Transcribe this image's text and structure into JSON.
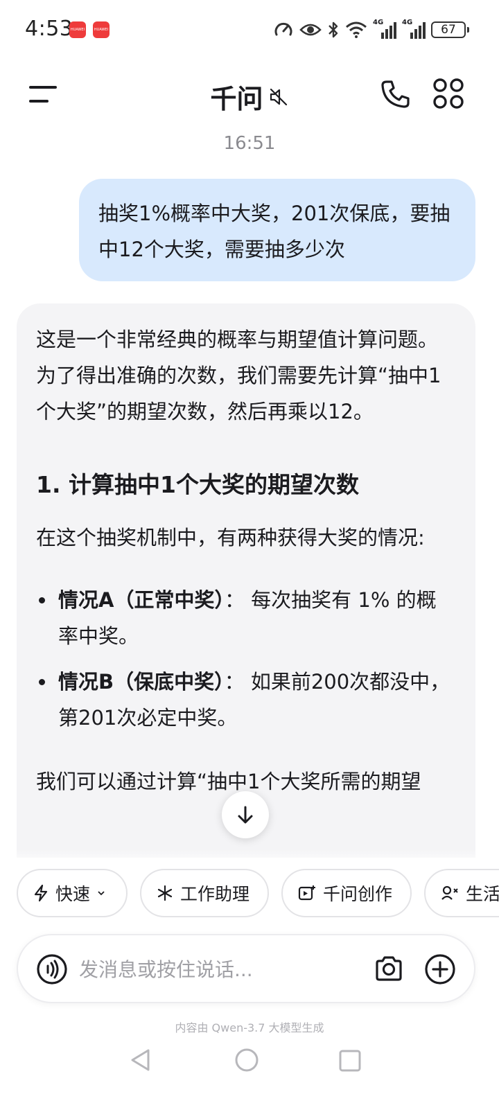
{
  "status_bar": {
    "time": "4:53",
    "badges": [
      "HUAWEI",
      "HUAWEI"
    ],
    "network1": "4G",
    "network2": "4G",
    "battery": "67",
    "icons": [
      "data-saver-icon",
      "eye-comfort-icon",
      "bluetooth-icon",
      "wifi-icon",
      "signal-icon",
      "signal-icon",
      "battery-icon"
    ]
  },
  "header": {
    "title": "千问",
    "icons": [
      "menu-icon",
      "mute-icon",
      "phone-icon",
      "apps-grid-icon"
    ]
  },
  "chat": {
    "timestamp": "16:51",
    "user_message": "抽奖1%概率中大奖，201次保底，要抽中12个大奖，需要抽多少次",
    "assistant": {
      "intro": "这是一个非常经典的概率与期望值计算问题。为了得出准确的次数，我们需要先计算“抽中1个大奖”的期望次数，然后再乘以12。",
      "heading": "1. 计算抽中1个大奖的期望次数",
      "paragraph": "在这个抽奖机制中，有两种获得大奖的情况:",
      "bullets": [
        {
          "label": "情况A（正常中奖）",
          "text": "： 每次抽奖有 1% 的概率中奖。"
        },
        {
          "label": "情况B（保底中奖）",
          "text": "： 如果前200次都没中，第201次必定中奖。"
        }
      ],
      "cut_text": "我们可以通过计算“抽中1个大奖所需的期望"
    }
  },
  "mode_chips": [
    {
      "label": "快速",
      "icon": "lightning-icon"
    },
    {
      "label": "工作助理",
      "icon": "sparkle-icon"
    },
    {
      "label": "千问创作",
      "icon": "create-icon"
    },
    {
      "label": "生活",
      "icon": "life-icon"
    }
  ],
  "input": {
    "placeholder": "发消息或按住说话...",
    "value": ""
  },
  "disclaimer": "内容由 Qwen-3.7 大模型生成",
  "colors": {
    "user_bubble": "#d8e9fd",
    "assistant_card": "#f4f4f6",
    "text": "#1b1b1f",
    "muted": "#8a8a8f"
  }
}
